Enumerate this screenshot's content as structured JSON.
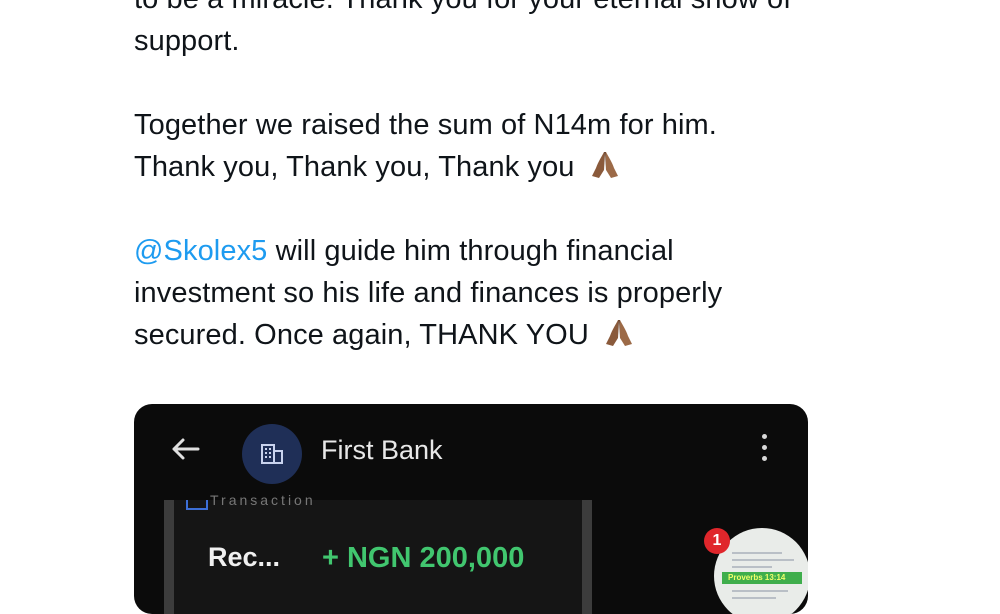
{
  "tweet": {
    "clipped_line": "to be a miracle. Thank you for your eternal show of",
    "line_support": "support.",
    "line_raised": "Together we raised the sum of N14m for him.",
    "line_thanks": "Thank you, Thank you, Thank you",
    "mention": "@Skolex5",
    "line_guide": " will guide him through financial",
    "line_investment": "investment so his life and finances is properly",
    "line_secured": "secured. Once again, THANK YOU",
    "emoji_icon": "folded-hands-icon"
  },
  "screenshot": {
    "bank_name": "First Bank",
    "section_label": "Transaction",
    "received_label": "Rec...",
    "amount": "+ NGN 200,000",
    "notification_count": "1",
    "thumbnail_caption": "Proverbs 13:14",
    "colors": {
      "background": "#0b0b0b",
      "amount_green": "#41c66f",
      "badge_red": "#e0262b",
      "avatar_blue": "#1f2f57"
    }
  }
}
